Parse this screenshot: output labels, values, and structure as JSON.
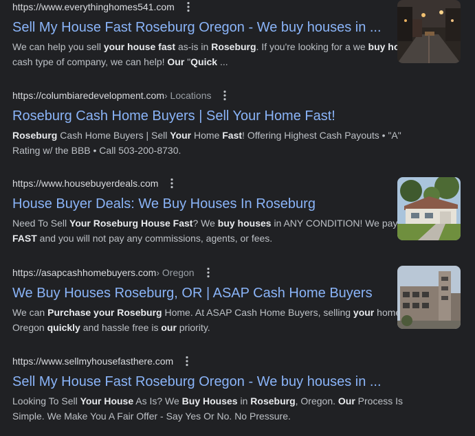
{
  "results": [
    {
      "url": "https://www.everythinghomes541.com",
      "breadcrumb": "",
      "title": "Sell My House Fast Roseburg Oregon - We buy houses in ...",
      "snippet_parts": [
        {
          "t": "We can help you sell ",
          "b": false
        },
        {
          "t": "your house fast",
          "b": true
        },
        {
          "t": " as-is in ",
          "b": false
        },
        {
          "t": "Roseburg",
          "b": true
        },
        {
          "t": ". If you're looking for a we ",
          "b": false
        },
        {
          "t": "buy houses",
          "b": true
        },
        {
          "t": " cash type of company, we can help! ",
          "b": false
        },
        {
          "t": "Our",
          "b": true
        },
        {
          "t": " \"",
          "b": false
        },
        {
          "t": "Quick",
          "b": true
        },
        {
          "t": " ...",
          "b": false
        }
      ],
      "thumbnail": "street-at-night-photo"
    },
    {
      "url": "https://columbiaredevelopment.com",
      "breadcrumb": " › Locations",
      "title": "Roseburg Cash Home Buyers | Sell Your Home Fast!",
      "snippet_parts": [
        {
          "t": "Roseburg",
          "b": true
        },
        {
          "t": " Cash Home Buyers | Sell ",
          "b": false
        },
        {
          "t": "Your",
          "b": true
        },
        {
          "t": " Home ",
          "b": false
        },
        {
          "t": "Fast",
          "b": true
        },
        {
          "t": "! Offering Highest Cash Payouts • \"A\" Rating w/ the BBB • Call 503-200-8730.",
          "b": false
        }
      ],
      "thumbnail": ""
    },
    {
      "url": "https://www.housebuyerdeals.com",
      "breadcrumb": "",
      "title": "House Buyer Deals: We Buy Houses In Roseburg",
      "snippet_parts": [
        {
          "t": "Need To Sell ",
          "b": false
        },
        {
          "t": "Your Roseburg House Fast",
          "b": true
        },
        {
          "t": "? We ",
          "b": false
        },
        {
          "t": "buy houses",
          "b": true
        },
        {
          "t": " in ANY CONDITION! We pay ",
          "b": false
        },
        {
          "t": "FAST",
          "b": true
        },
        {
          "t": " and you will not pay any commissions, agents, or fees.",
          "b": false
        }
      ],
      "thumbnail": "house-photo"
    },
    {
      "url": "https://asapcashhomebuyers.com",
      "breadcrumb": " › Oregon",
      "title": "We Buy Houses Roseburg, OR | ASAP Cash Home Buyers",
      "snippet_parts": [
        {
          "t": "We can ",
          "b": false
        },
        {
          "t": "Purchase your Roseburg",
          "b": true
        },
        {
          "t": " Home. At ASAP Cash Home Buyers, selling ",
          "b": false
        },
        {
          "t": "your",
          "b": true
        },
        {
          "t": " home in Oregon ",
          "b": false
        },
        {
          "t": "quickly",
          "b": true
        },
        {
          "t": " and hassle free is ",
          "b": false
        },
        {
          "t": "our",
          "b": true
        },
        {
          "t": " priority.",
          "b": false
        }
      ],
      "thumbnail": "building-photo"
    },
    {
      "url": "https://www.sellmyhousefasthere.com",
      "breadcrumb": "",
      "title": "Sell My House Fast Roseburg Oregon - We buy houses in ...",
      "snippet_parts": [
        {
          "t": "Looking To Sell ",
          "b": false
        },
        {
          "t": "Your House",
          "b": true
        },
        {
          "t": " As Is? We ",
          "b": false
        },
        {
          "t": "Buy Houses",
          "b": true
        },
        {
          "t": " in ",
          "b": false
        },
        {
          "t": "Roseburg",
          "b": true
        },
        {
          "t": ", Oregon. ",
          "b": false
        },
        {
          "t": "Our",
          "b": true
        },
        {
          "t": " Process Is Simple. We Make You A Fair Offer - Say Yes Or No. No Pressure.",
          "b": false
        }
      ],
      "thumbnail": ""
    }
  ],
  "icons": {
    "more": "more-vert-icon"
  }
}
